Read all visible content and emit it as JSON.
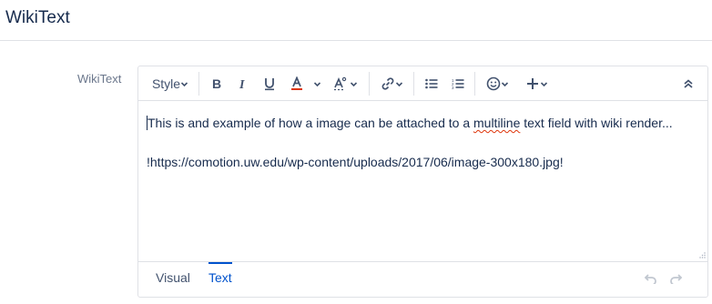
{
  "header": {
    "title": "WikiText"
  },
  "field": {
    "label": "WikiText"
  },
  "toolbar": {
    "style_label": "Style",
    "buttons": [
      "bold-icon",
      "italic-icon",
      "underline-icon",
      "text-color-icon",
      "text-effects-icon",
      "link-icon",
      "bullet-list-icon",
      "numbered-list-icon",
      "emoji-icon",
      "insert-icon",
      "collapse-icon"
    ],
    "text_color": "#de350b"
  },
  "content": {
    "line1_before": "This is and example of how a image can be attached to a ",
    "line1_misspelled": "multiline",
    "line1_after": " text field with wiki render...",
    "line2": "!https://comotion.uw.edu/wp-content/uploads/2017/06/image-300x180.jpg!"
  },
  "footer": {
    "tabs": [
      {
        "label": "Visual",
        "active": false
      },
      {
        "label": "Text",
        "active": true
      }
    ]
  },
  "colors": {
    "accent": "#0052cc",
    "text": "#172b4d",
    "muted": "#6b778c",
    "border": "#dfe1e6"
  }
}
